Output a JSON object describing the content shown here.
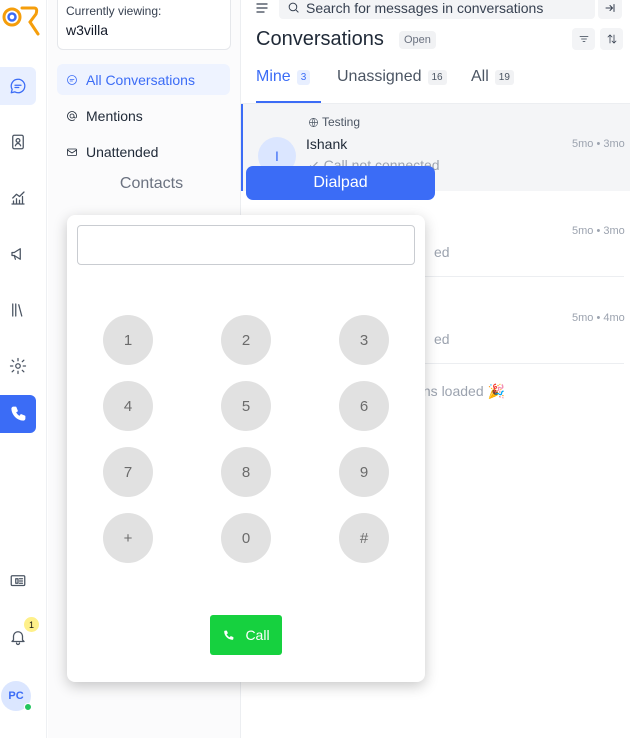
{
  "sidebar": {
    "viewing_label": "Currently viewing:",
    "viewing_value": "w3villa",
    "items": [
      {
        "label": "All Conversations",
        "icon": "chat-icon",
        "active": true
      },
      {
        "label": "Mentions",
        "icon": "at-icon",
        "active": false
      },
      {
        "label": "Unattended",
        "icon": "mail-icon",
        "active": false
      }
    ]
  },
  "rail": {
    "icons": [
      "logo",
      "chat-icon",
      "contacts-icon",
      "reports-icon",
      "campaigns-icon",
      "library-icon",
      "settings-icon",
      "phone-icon",
      "dashboard-icon",
      "bell-icon"
    ],
    "notification_count": "1",
    "avatar_initials": "PC",
    "accent": "#3b6cf6"
  },
  "header": {
    "search_placeholder": "Search for messages in conversations",
    "title": "Conversations",
    "status": "Open"
  },
  "tabs": [
    {
      "label": "Mine",
      "count": "3",
      "active": true
    },
    {
      "label": "Unassigned",
      "count": "16",
      "active": false
    },
    {
      "label": "All",
      "count": "19",
      "active": false
    }
  ],
  "conversations": [
    {
      "inbox": "Testing",
      "name": "Ishank",
      "avatar": "I",
      "message": "Call not connected",
      "time": "5mo • 3mo"
    },
    {
      "message_fragment": "ed",
      "time": "5mo • 3mo"
    },
    {
      "message_fragment": "ed",
      "time": "5mo • 4mo"
    }
  ],
  "loaded_fragment": "ions loaded 🎉",
  "phone_panel": {
    "tabs": [
      "Contacts",
      "Dialpad"
    ],
    "active_tab": "Dialpad",
    "input_value": "",
    "keys": [
      "1",
      "2",
      "3",
      "4",
      "5",
      "6",
      "7",
      "8",
      "9",
      "+",
      "0",
      "#"
    ],
    "call_label": "Call",
    "call_color": "#16d13f"
  }
}
